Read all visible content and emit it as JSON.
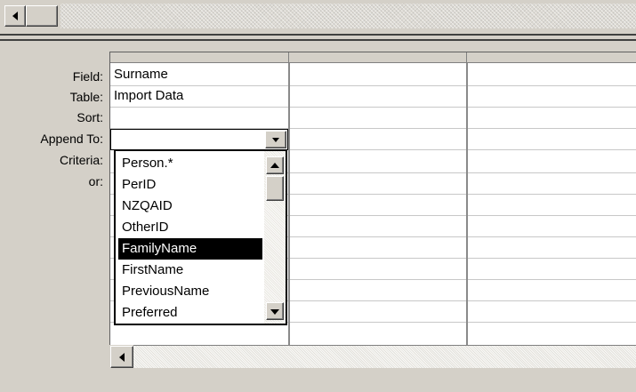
{
  "row_labels": {
    "field": "Field:",
    "table": "Table:",
    "sort": "Sort:",
    "append_to": "Append To:",
    "criteria": "Criteria:",
    "or": "or:"
  },
  "column1": {
    "field": "Surname",
    "table": "Import Data",
    "sort": "",
    "append_to": ""
  },
  "append_to_dropdown": {
    "items": [
      "Person.*",
      "PerID",
      "NZQAID",
      "OtherID",
      "FamilyName",
      "FirstName",
      "PreviousName",
      "Preferred"
    ],
    "selected_index": 4
  },
  "icons": {
    "scroll_left": "scroll-left-arrow-icon",
    "scroll_up": "scroll-up-arrow-icon",
    "scroll_down": "scroll-down-arrow-icon",
    "dropdown": "dropdown-arrow-icon"
  },
  "colors": {
    "selection_bg": "#000000",
    "selection_fg": "#ffffff",
    "window_face": "#d4d0c8"
  }
}
